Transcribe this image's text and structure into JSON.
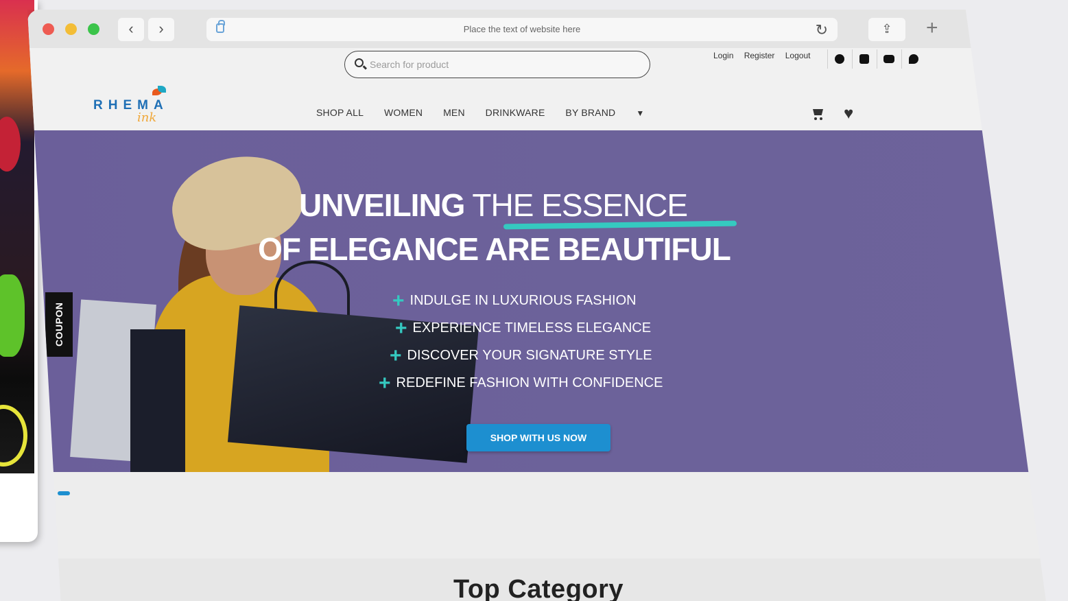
{
  "browser": {
    "url_text": "Place the text of website here"
  },
  "site": {
    "search_placeholder": "Search for product",
    "auth": [
      "Login",
      "Register",
      "Logout"
    ],
    "social": [
      "facebook-icon",
      "instagram-icon",
      "youtube-icon",
      "twitter-icon"
    ],
    "logo": {
      "word": "RHEMA",
      "ink": "ink"
    },
    "nav": [
      "SHOP ALL",
      "WOMEN",
      "MEN",
      "DRINKWARE",
      "BY BRAND"
    ]
  },
  "hero": {
    "coupon": "COUPON",
    "headline1_bold": "UNVEILING",
    "headline1_thin": "THE ESSENCE",
    "headline2": "OF ELEGANCE ARE BEAUTIFUL",
    "bullets": [
      "INDULGE IN LUXURIOUS FASHION",
      "EXPERIENCE TIMELESS ELEGANCE",
      "DISCOVER YOUR SIGNATURE STYLE",
      "REDEFINE FASHION WITH CONFIDENCE"
    ],
    "cta": "SHOP WITH US NOW"
  },
  "section": {
    "title": "Top Category"
  },
  "colors": {
    "hero_bg": "#6b5f9a",
    "accent": "#35c9c0",
    "cta": "#1d8fd0"
  }
}
